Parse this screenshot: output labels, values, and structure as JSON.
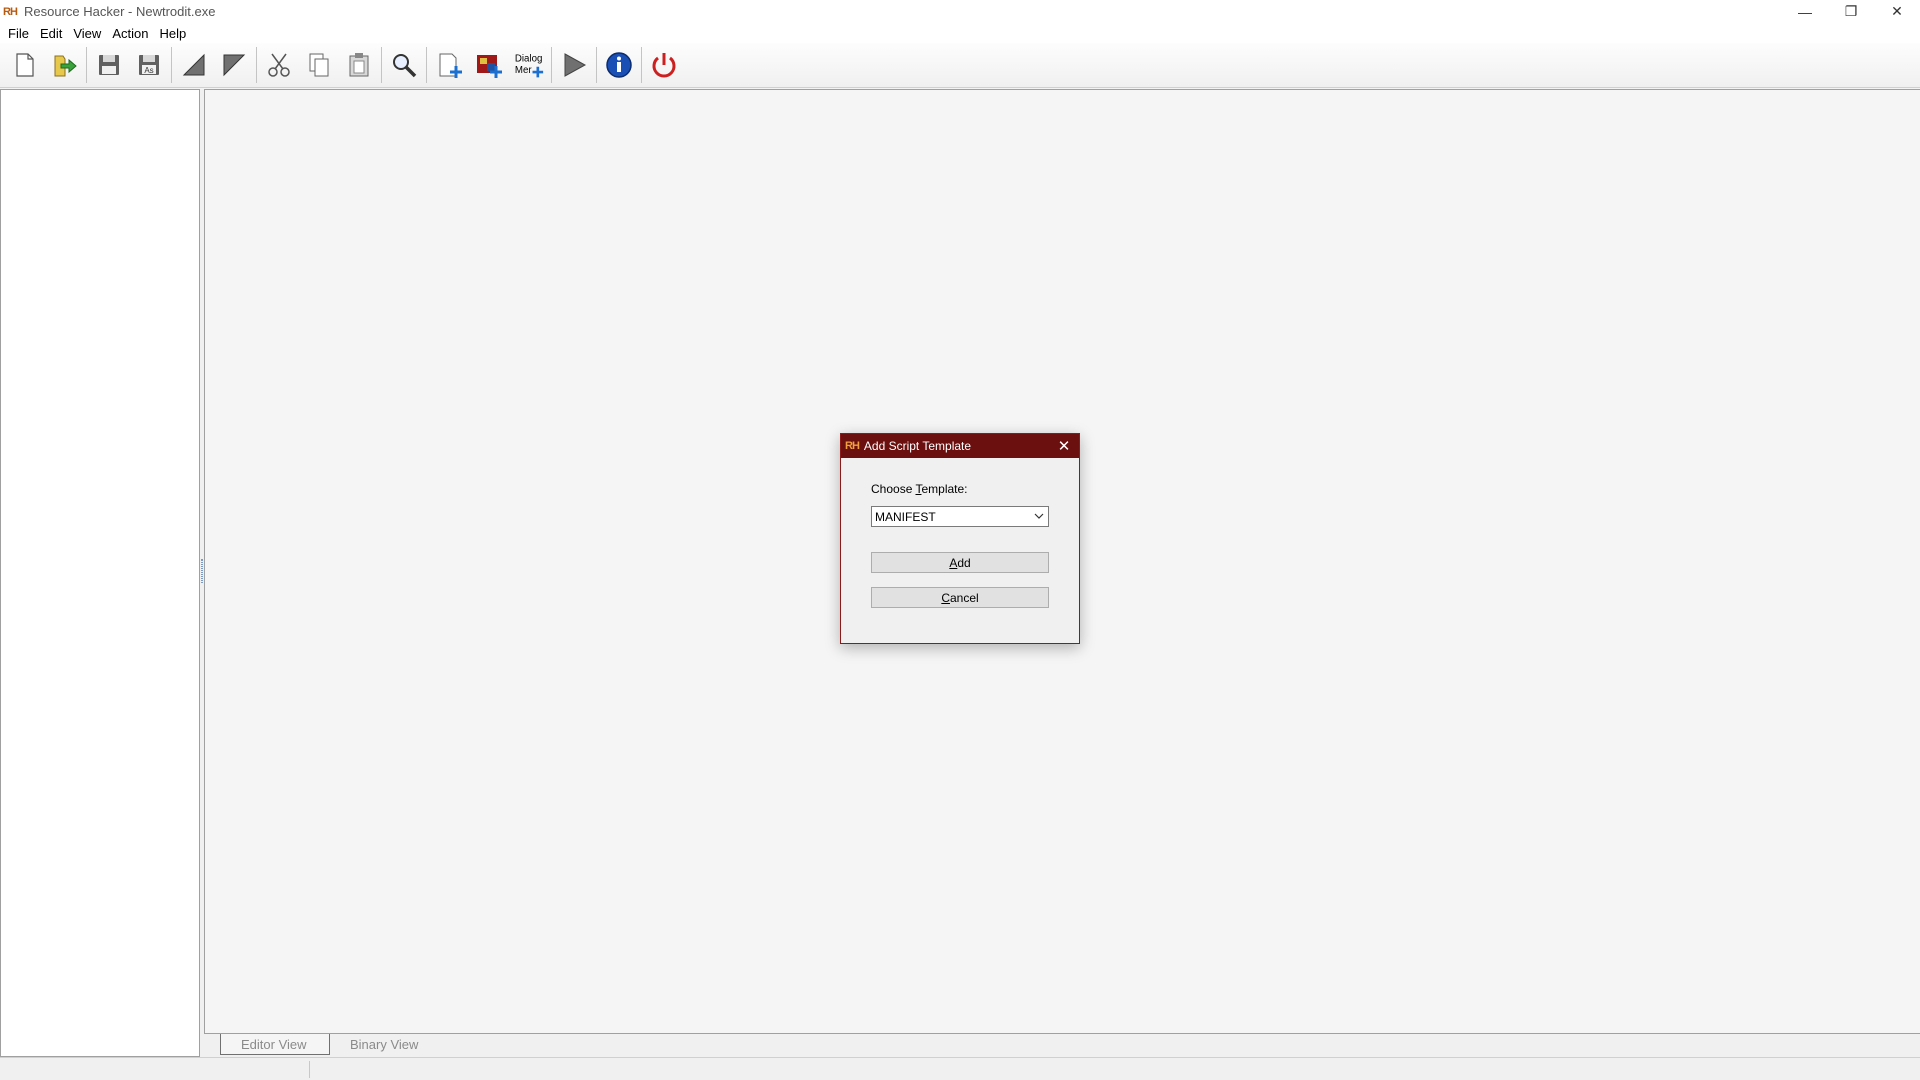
{
  "window": {
    "title": "Resource Hacker - Newtrodit.exe",
    "icon_text": "RH",
    "controls": {
      "minimize": "—",
      "restore": "❐",
      "close": "✕"
    }
  },
  "menu": [
    "File",
    "Edit",
    "View",
    "Action",
    "Help"
  ],
  "toolbar": {
    "dialog_menu_label_line1": "Dialog",
    "dialog_menu_label_line2": "Mer"
  },
  "tabs": {
    "editor": "Editor View",
    "binary": "Binary View"
  },
  "dialog": {
    "icon_text": "RH",
    "title": "Add Script Template",
    "close": "✕",
    "label_pre": "Choose ",
    "label_accel": "T",
    "label_post": "emplate:",
    "selected": "MANIFEST",
    "add_accel": "A",
    "add_rest": "dd",
    "cancel_accel": "C",
    "cancel_rest": "ancel"
  },
  "colors": {
    "dialog_title_bg": "#6b0f0f",
    "accent_red": "#cc1f1f",
    "info_blue": "#1a4fb5"
  }
}
